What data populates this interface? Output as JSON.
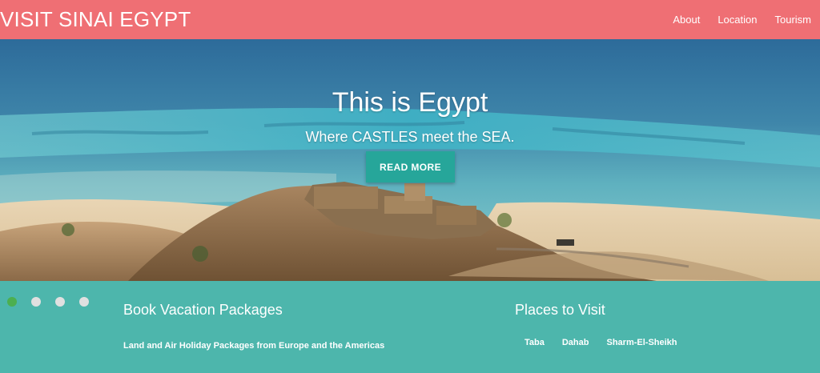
{
  "nav": {
    "brand": "VISIT SINAI EGYPT",
    "links": [
      "About",
      "Location",
      "Tourism"
    ]
  },
  "hero": {
    "title": "This is Egypt",
    "subtitle": "Where CASTLES meet the SEA.",
    "button_label": "READ MORE"
  },
  "carousel": {
    "slide_count": 4,
    "active_index": 0
  },
  "footer": {
    "packages": {
      "title": "Book Vacation Packages",
      "text": "Land and Air Holiday Packages from Europe and the Americas"
    },
    "places": {
      "title": "Places to Visit",
      "links": [
        "Taba",
        "Dahab",
        "Sharm-El-Sheikh"
      ]
    }
  },
  "colors": {
    "navbar": "#ef6f74",
    "footer": "#4db6ac",
    "button": "#26a69a",
    "active_dot": "#4caf50",
    "inactive_dot": "#e0e0e0"
  }
}
